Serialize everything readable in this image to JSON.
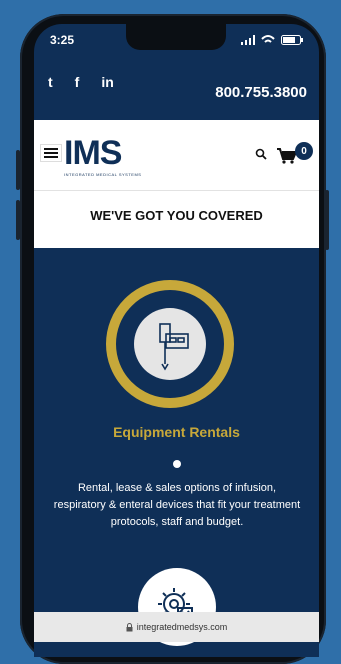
{
  "status": {
    "time": "3:25"
  },
  "social": {
    "icons": [
      "twitter-icon",
      "facebook-icon",
      "linkedin-icon"
    ],
    "twitter": "t",
    "facebook": "f",
    "linkedin": "in",
    "phone": "800.755.3800"
  },
  "header": {
    "logo": "IMS",
    "logo_sub": "INTEGRATED MEDICAL SYSTEMS",
    "cart_count": "0",
    "tagline": "WE'VE GOT YOU COVERED"
  },
  "hero": {
    "title": "Equipment Rentals",
    "description": "Rental, lease & sales options of infusion, respiratory & enteral devices that fit your treatment protocols, staff and budget."
  },
  "browser": {
    "url": "integratedmedsys.com"
  },
  "colors": {
    "navy": "#0f2f57",
    "gold": "#c7a83a",
    "background": "#2f6fa9"
  }
}
